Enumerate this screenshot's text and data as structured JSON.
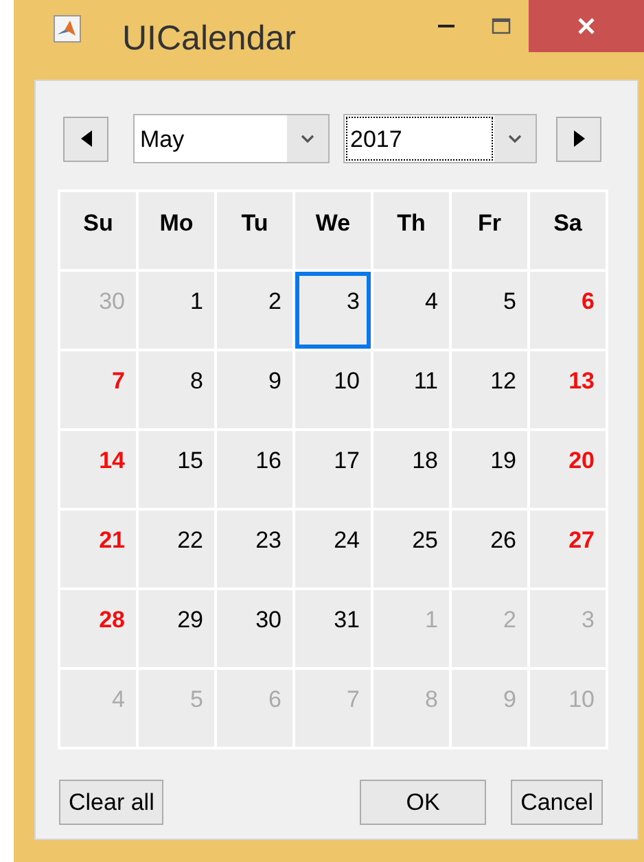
{
  "window": {
    "title": "UICalendar"
  },
  "month": {
    "value": "May"
  },
  "year": {
    "value": "2017"
  },
  "weekdays": [
    "Su",
    "Mo",
    "Tu",
    "We",
    "Th",
    "Fr",
    "Sa"
  ],
  "weeks": [
    [
      {
        "text": "30",
        "kind": "other",
        "selected": false
      },
      {
        "text": "1",
        "kind": "normal",
        "selected": false
      },
      {
        "text": "2",
        "kind": "normal",
        "selected": false
      },
      {
        "text": "3",
        "kind": "normal",
        "selected": true
      },
      {
        "text": "4",
        "kind": "normal",
        "selected": false
      },
      {
        "text": "5",
        "kind": "normal",
        "selected": false
      },
      {
        "text": "6",
        "kind": "weekend",
        "selected": false
      }
    ],
    [
      {
        "text": "7",
        "kind": "weekend",
        "selected": false
      },
      {
        "text": "8",
        "kind": "normal",
        "selected": false
      },
      {
        "text": "9",
        "kind": "normal",
        "selected": false
      },
      {
        "text": "10",
        "kind": "normal",
        "selected": false
      },
      {
        "text": "11",
        "kind": "normal",
        "selected": false
      },
      {
        "text": "12",
        "kind": "normal",
        "selected": false
      },
      {
        "text": "13",
        "kind": "weekend",
        "selected": false
      }
    ],
    [
      {
        "text": "14",
        "kind": "weekend",
        "selected": false
      },
      {
        "text": "15",
        "kind": "normal",
        "selected": false
      },
      {
        "text": "16",
        "kind": "normal",
        "selected": false
      },
      {
        "text": "17",
        "kind": "normal",
        "selected": false
      },
      {
        "text": "18",
        "kind": "normal",
        "selected": false
      },
      {
        "text": "19",
        "kind": "normal",
        "selected": false
      },
      {
        "text": "20",
        "kind": "weekend",
        "selected": false
      }
    ],
    [
      {
        "text": "21",
        "kind": "weekend",
        "selected": false
      },
      {
        "text": "22",
        "kind": "normal",
        "selected": false
      },
      {
        "text": "23",
        "kind": "normal",
        "selected": false
      },
      {
        "text": "24",
        "kind": "normal",
        "selected": false
      },
      {
        "text": "25",
        "kind": "normal",
        "selected": false
      },
      {
        "text": "26",
        "kind": "normal",
        "selected": false
      },
      {
        "text": "27",
        "kind": "weekend",
        "selected": false
      }
    ],
    [
      {
        "text": "28",
        "kind": "weekend",
        "selected": false
      },
      {
        "text": "29",
        "kind": "normal",
        "selected": false
      },
      {
        "text": "30",
        "kind": "normal",
        "selected": false
      },
      {
        "text": "31",
        "kind": "normal",
        "selected": false
      },
      {
        "text": "1",
        "kind": "other",
        "selected": false
      },
      {
        "text": "2",
        "kind": "other",
        "selected": false
      },
      {
        "text": "3",
        "kind": "other",
        "selected": false
      }
    ],
    [
      {
        "text": "4",
        "kind": "other",
        "selected": false
      },
      {
        "text": "5",
        "kind": "other",
        "selected": false
      },
      {
        "text": "6",
        "kind": "other",
        "selected": false
      },
      {
        "text": "7",
        "kind": "other",
        "selected": false
      },
      {
        "text": "8",
        "kind": "other",
        "selected": false
      },
      {
        "text": "9",
        "kind": "other",
        "selected": false
      },
      {
        "text": "10",
        "kind": "other",
        "selected": false
      }
    ]
  ],
  "buttons": {
    "clear": "Clear all",
    "ok": "OK",
    "cancel": "Cancel"
  }
}
